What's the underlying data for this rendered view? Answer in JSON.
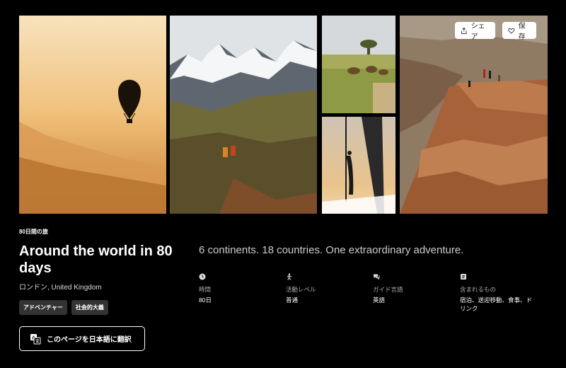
{
  "actions": {
    "share_label": "シェア",
    "save_label": "保存"
  },
  "experience": {
    "eyebrow": "80日間の旅",
    "title": "Around the world in 80 days",
    "location": "ロンドン, United Kingdom",
    "tags": [
      "アドベンチャー",
      "社会的大義"
    ],
    "translate_label": "このページを日本語に翻訳",
    "headline": "6 continents. 18 countries. One extraordinary adventure."
  },
  "details": [
    {
      "icon": "clock-icon",
      "label": "時間",
      "value": "80日"
    },
    {
      "icon": "activity-icon",
      "label": "活動レベル",
      "value": "普通"
    },
    {
      "icon": "chat-icon",
      "label": "ガイド言語",
      "value": "英語"
    },
    {
      "icon": "list-icon",
      "label": "含まれるもの",
      "value": "宿泊、送迎移動、食事、ドリンク"
    }
  ],
  "photos": [
    {
      "icon": "hot-air-balloon-photo"
    },
    {
      "icon": "mountain-hikers-photo"
    },
    {
      "icon": "safari-gazelles-photo"
    },
    {
      "icon": "sailing-boat-photo"
    },
    {
      "icon": "canyon-overlook-photo"
    }
  ]
}
